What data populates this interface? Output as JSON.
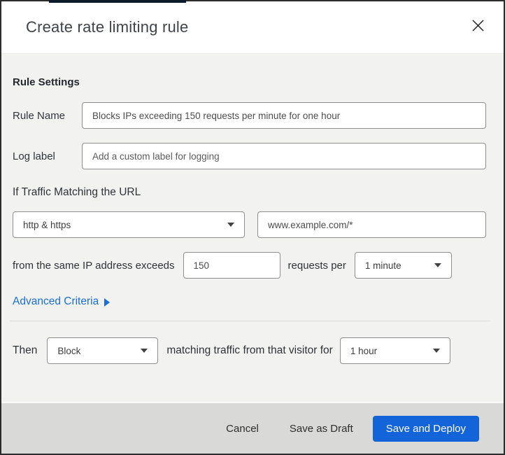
{
  "header": {
    "title": "Create rate limiting rule"
  },
  "icons": {
    "close": "close-x",
    "dropdown_caret": "▼",
    "advanced_arrow": "▶"
  },
  "body": {
    "section_title": "Rule Settings",
    "rule_name": {
      "label": "Rule Name",
      "value": "Blocks IPs exceeding 150 requests per minute for one hour"
    },
    "log_label": {
      "label": "Log label",
      "placeholder": "Add a custom label for logging"
    },
    "traffic_match": {
      "label": "If Traffic Matching the URL",
      "scheme_selected": "http & https",
      "url_value": "www.example.com/*"
    },
    "threshold": {
      "prefix": "from the same IP address exceeds",
      "count_value": "150",
      "middle": "requests per",
      "period_selected": "1 minute"
    },
    "advanced_criteria_label": "Advanced Criteria"
  },
  "then_row": {
    "label": "Then",
    "action_selected": "Block",
    "middle": "matching traffic from that visitor for",
    "duration_selected": "1 hour"
  },
  "footer": {
    "cancel_label": "Cancel",
    "save_draft_label": "Save as Draft",
    "save_deploy_label": "Save and Deploy"
  },
  "colors": {
    "accent_blue": "#1a6fd4",
    "button_blue": "#1264d8",
    "top_strip": "#0c1b29"
  }
}
